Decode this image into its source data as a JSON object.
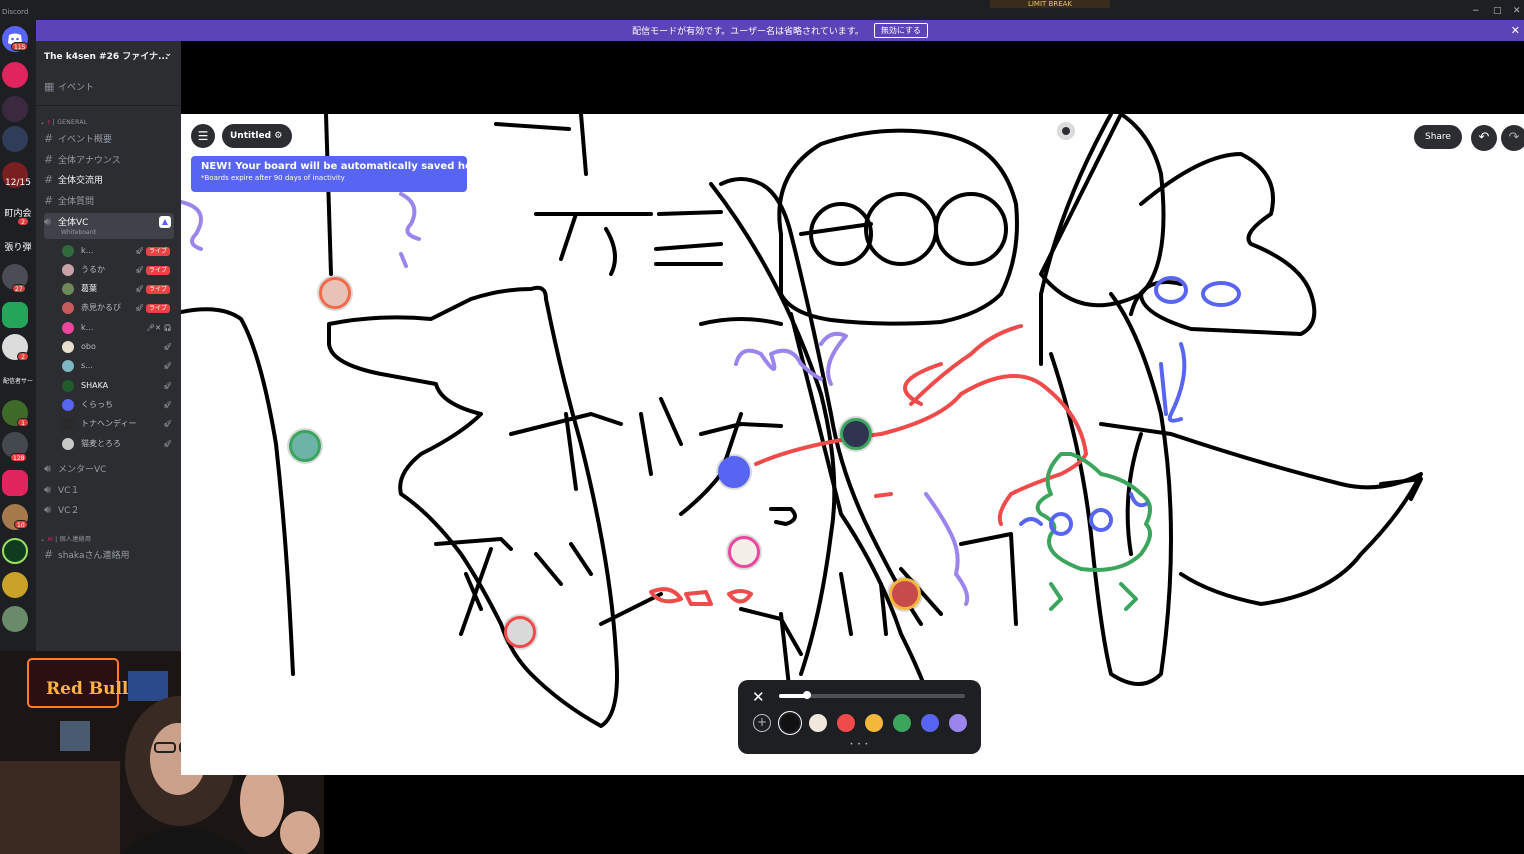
{
  "window": {
    "app_name": "Discord",
    "game_banner": "LIMIT BREAK",
    "controls": [
      "−",
      "□",
      "✕"
    ]
  },
  "streamer_banner": {
    "message": "配信モードが有効です。ユーザー名は省略されています。",
    "disable_label": "無効にする",
    "close": "✕"
  },
  "server_rail": {
    "badges": [
      "115",
      "2",
      "27",
      "2",
      "1",
      "128",
      "10"
    ],
    "text_servers": [
      "12/15",
      "町内会",
      "張り弾",
      "配信者サー"
    ]
  },
  "sidebar": {
    "server_name": "The k4sen #26 ファイナ...",
    "events_label": "イベント",
    "categories": {
      "general": "GENERAL",
      "personal": "個人連絡用"
    },
    "text_channels": [
      "イベント概要",
      "全体アナウンス",
      "全体交流用",
      "全体質問"
    ],
    "active_voice": {
      "name": "全体VC",
      "activity": "Whiteboard"
    },
    "voice_users": [
      {
        "name": "k...",
        "live": "ライブ"
      },
      {
        "name": "うるか",
        "live": "ライブ"
      },
      {
        "name": "葛葉",
        "live": "ライブ"
      },
      {
        "name": "赤見かるび",
        "live": "ライブ"
      },
      {
        "name": "k...",
        "live": ""
      },
      {
        "name": "obo",
        "live": ""
      },
      {
        "name": "s...",
        "live": ""
      },
      {
        "name": "SHAKA",
        "live": ""
      },
      {
        "name": "くらっち",
        "live": ""
      },
      {
        "name": "トナヘンディー",
        "live": ""
      },
      {
        "name": "猫麦とろろ",
        "live": ""
      }
    ],
    "voice_channels": [
      "メンターVC",
      "VC１",
      "VC２"
    ],
    "personal_channel": "shakaさん連絡用"
  },
  "whiteboard": {
    "board_title": "Untitled",
    "tooltip_title_strong": "NEW!",
    "tooltip_title": "Your board will be automatically saved here",
    "tooltip_subtitle": "*Boards expire after 90 days of inactivity",
    "share_label": "Share",
    "toolbar": {
      "brush_size": 0.15,
      "colors": [
        "#111111",
        "#f0e8dc",
        "#ef4b4b",
        "#f4b73b",
        "#3ba55d",
        "#5865f2",
        "#9b84ec"
      ],
      "selected_color": "#111111"
    }
  },
  "webcam": {
    "sign_text": "Red Bull"
  },
  "colors": {
    "banner": "#5c44b8",
    "sidebar": "#2b2d31",
    "rail": "#1e1f22",
    "live": "#ed4245",
    "blurple": "#5865f2"
  }
}
